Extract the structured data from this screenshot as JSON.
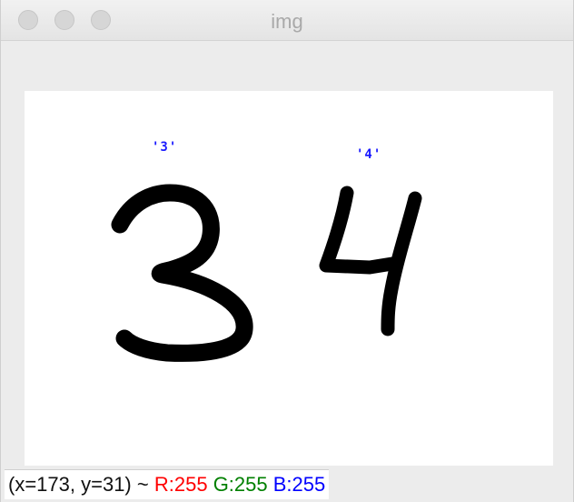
{
  "window": {
    "title": "img"
  },
  "image": {
    "labels": [
      {
        "text": "'3'"
      },
      {
        "text": "'4'"
      }
    ]
  },
  "status": {
    "position": "(x=173, y=31) ~",
    "r": "R:255",
    "g": "G:255",
    "b": "B:255"
  },
  "colors": {
    "label_blue": "#1a1aff",
    "r": "#ff0000",
    "g": "#008000",
    "b": "#0000ff"
  }
}
